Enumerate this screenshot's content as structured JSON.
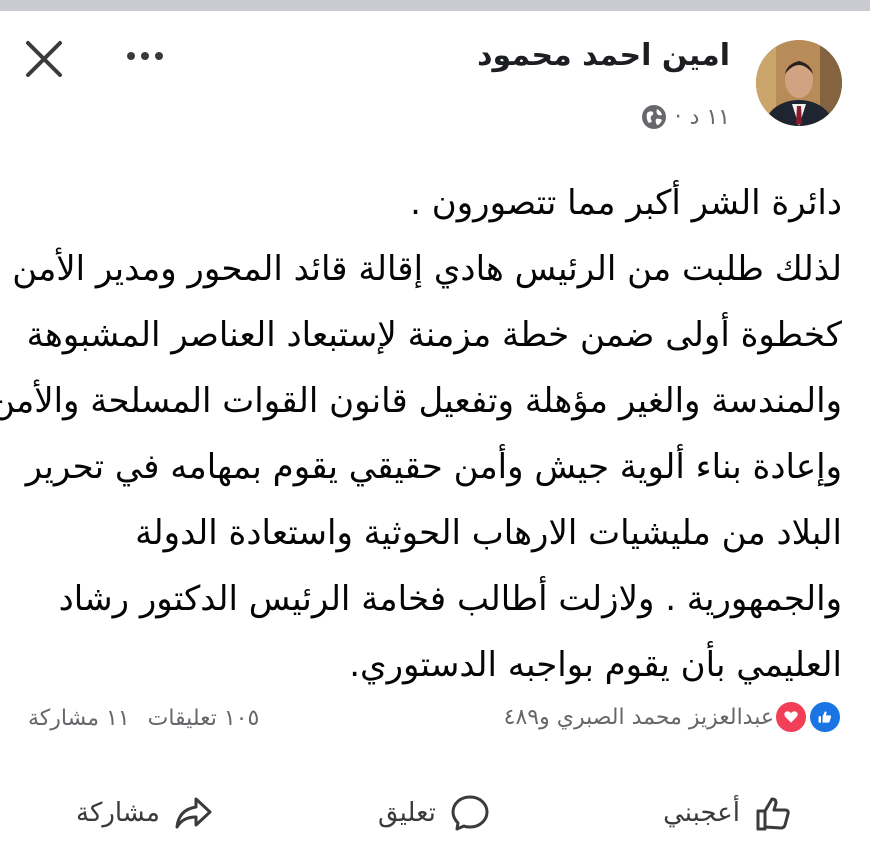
{
  "post": {
    "author_name": "امين احمد محمود",
    "time": "١١ د",
    "separator": "·",
    "lines": [
      "دائرة الشر أكبر مما تتصورون .",
      "لذلك طلبت من الرئيس هادي إقالة قائد المحور ومدير الأمن",
      "كخطوة أولى ضمن خطة مزمنة لإستبعاد العناصر المشبوهة",
      "والمندسة والغير مؤهلة وتفعيل قانون القوات المسلحة والأمن",
      "وإعادة بناء ألوية جيش وأمن حقيقي يقوم بمهامه في تحرير",
      "البلاد من مليشيات الارهاب الحوثية واستعادة الدولة",
      "والجمهورية . ولازلت أطالب فخامة الرئيس الدكتور رشاد",
      "العليمي بأن يقوم بواجبه الدستوري."
    ]
  },
  "reactions": {
    "summary": "عبدالعزيز محمد الصبري و٤٨٩",
    "comments": "١٠٥ تعليقات",
    "shares": "١١ مشاركة"
  },
  "actions": {
    "like": "أعجبني",
    "comment": "تعليق",
    "share": "مشاركة"
  },
  "colors": {
    "like_blue": "#1b74e4",
    "love_red": "#f33e58",
    "secondary_text": "#65676b"
  },
  "icons": [
    "close-icon",
    "more-icon",
    "globe-icon",
    "like-reaction-icon",
    "love-reaction-icon",
    "thumbs-up-icon",
    "comment-icon",
    "share-icon"
  ]
}
